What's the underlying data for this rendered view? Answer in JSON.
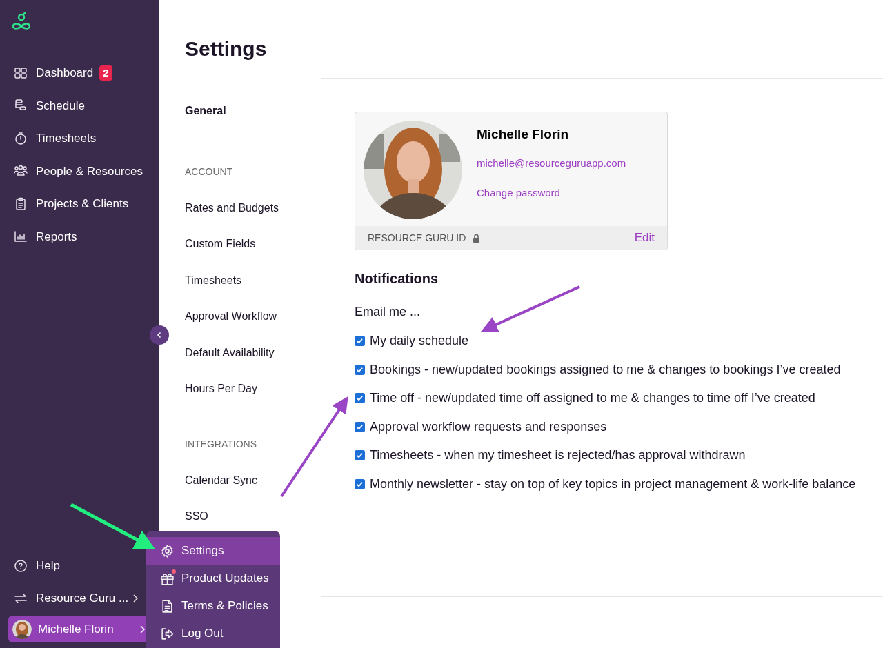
{
  "sidebar": {
    "items": [
      {
        "label": "Dashboard",
        "badge": "2"
      },
      {
        "label": "Schedule"
      },
      {
        "label": "Timesheets"
      },
      {
        "label": "People & Resources"
      },
      {
        "label": "Projects & Clients"
      },
      {
        "label": "Reports"
      }
    ],
    "bottom_items": [
      {
        "label": "Help"
      },
      {
        "label": "Resource Guru ..."
      }
    ],
    "user": {
      "name": "Michelle Florin"
    }
  },
  "user_menu": {
    "items": [
      {
        "label": "Settings",
        "selected": true,
        "dot": false
      },
      {
        "label": "Product Updates",
        "selected": false,
        "dot": true
      },
      {
        "label": "Terms & Policies",
        "selected": false,
        "dot": false
      },
      {
        "label": "Log Out",
        "selected": false,
        "dot": false
      }
    ]
  },
  "page_title": "Settings",
  "settings_nav": [
    {
      "kind": "item",
      "label": "General",
      "selected": true
    },
    {
      "kind": "heading",
      "label": "ACCOUNT"
    },
    {
      "kind": "item",
      "label": "Rates and Budgets",
      "selected": false
    },
    {
      "kind": "item",
      "label": "Custom Fields",
      "selected": false
    },
    {
      "kind": "item",
      "label": "Timesheets",
      "selected": false
    },
    {
      "kind": "item",
      "label": "Approval Workflow",
      "selected": false
    },
    {
      "kind": "item",
      "label": "Default Availability",
      "selected": false
    },
    {
      "kind": "item",
      "label": "Hours Per Day",
      "selected": false
    },
    {
      "kind": "heading",
      "label": "INTEGRATIONS"
    },
    {
      "kind": "item",
      "label": "Calendar Sync",
      "selected": false
    },
    {
      "kind": "item",
      "label": "SSO",
      "selected": false
    }
  ],
  "profile": {
    "name": "Michelle Florin",
    "email": "michelle@resourceguruapp.com",
    "change_password": "Change password",
    "id_label": "RESOURCE GURU ID",
    "edit": "Edit"
  },
  "notifications": {
    "title": "Notifications",
    "intro": "Email me ...",
    "options": [
      {
        "label": "My daily schedule",
        "checked": true
      },
      {
        "label": "Bookings - new/updated bookings assigned to me & changes to bookings I’ve created",
        "checked": true
      },
      {
        "label": "Time off - new/updated time off assigned to me & changes to time off I’ve created",
        "checked": true
      },
      {
        "label": "Approval workflow requests and responses",
        "checked": true
      },
      {
        "label": "Timesheets - when my timesheet is rejected/has approval withdrawn",
        "checked": true
      },
      {
        "label": "Monthly newsletter - stay on top of key topics in project management & work-life balance",
        "checked": true
      }
    ]
  }
}
